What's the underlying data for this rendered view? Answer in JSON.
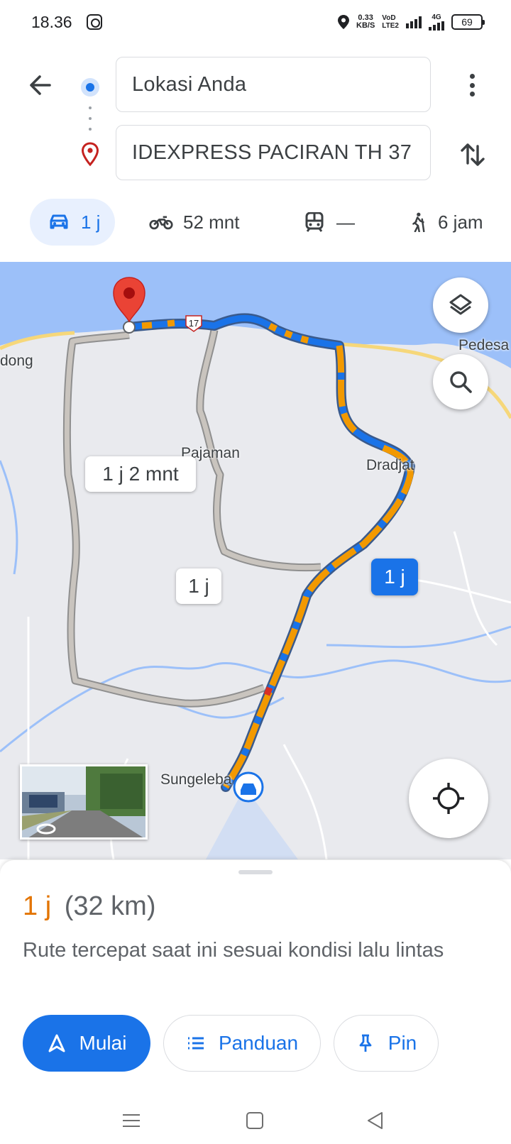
{
  "status_bar": {
    "time": "18.36",
    "net_speed_value": "0.33",
    "net_speed_unit": "KB/S",
    "volte_top": "VoD",
    "volte_bottom": "LTE2",
    "network_label": "4G",
    "battery": "69"
  },
  "directions": {
    "origin": "Lokasi Anda",
    "destination": "IDEXPRESS PACIRAN TH 37"
  },
  "modes": [
    {
      "name": "car",
      "label": "1 j",
      "icon": "car-icon"
    },
    {
      "name": "motorcycle",
      "label": "52 mnt",
      "icon": "motorcycle-icon"
    },
    {
      "name": "transit",
      "label": "—",
      "icon": "train-icon"
    },
    {
      "name": "walk",
      "label": "6 jam",
      "icon": "walking-icon"
    }
  ],
  "map": {
    "place_labels": [
      "Pajaman",
      "Dradjat",
      "Sungeleba",
      "Pedesa",
      "dong"
    ],
    "road_shield": "17",
    "route_bubbles": [
      {
        "label": "1 j 2 mnt",
        "selected": false
      },
      {
        "label": "1 j",
        "selected": false
      },
      {
        "label": "1 j",
        "selected": true
      }
    ],
    "colors": {
      "water": "#9cc0f9",
      "land": "#e9eaee",
      "route_blue": "#1a73e8",
      "traffic_orange": "#f29900",
      "alt_route": "#b6b1ab"
    }
  },
  "summary": {
    "time": "1 j",
    "distance": "(32 km)",
    "description": "Rute tercepat saat ini sesuai kondisi lalu lintas"
  },
  "actions": {
    "start": "Mulai",
    "guide": "Panduan",
    "pin": "Pin"
  }
}
